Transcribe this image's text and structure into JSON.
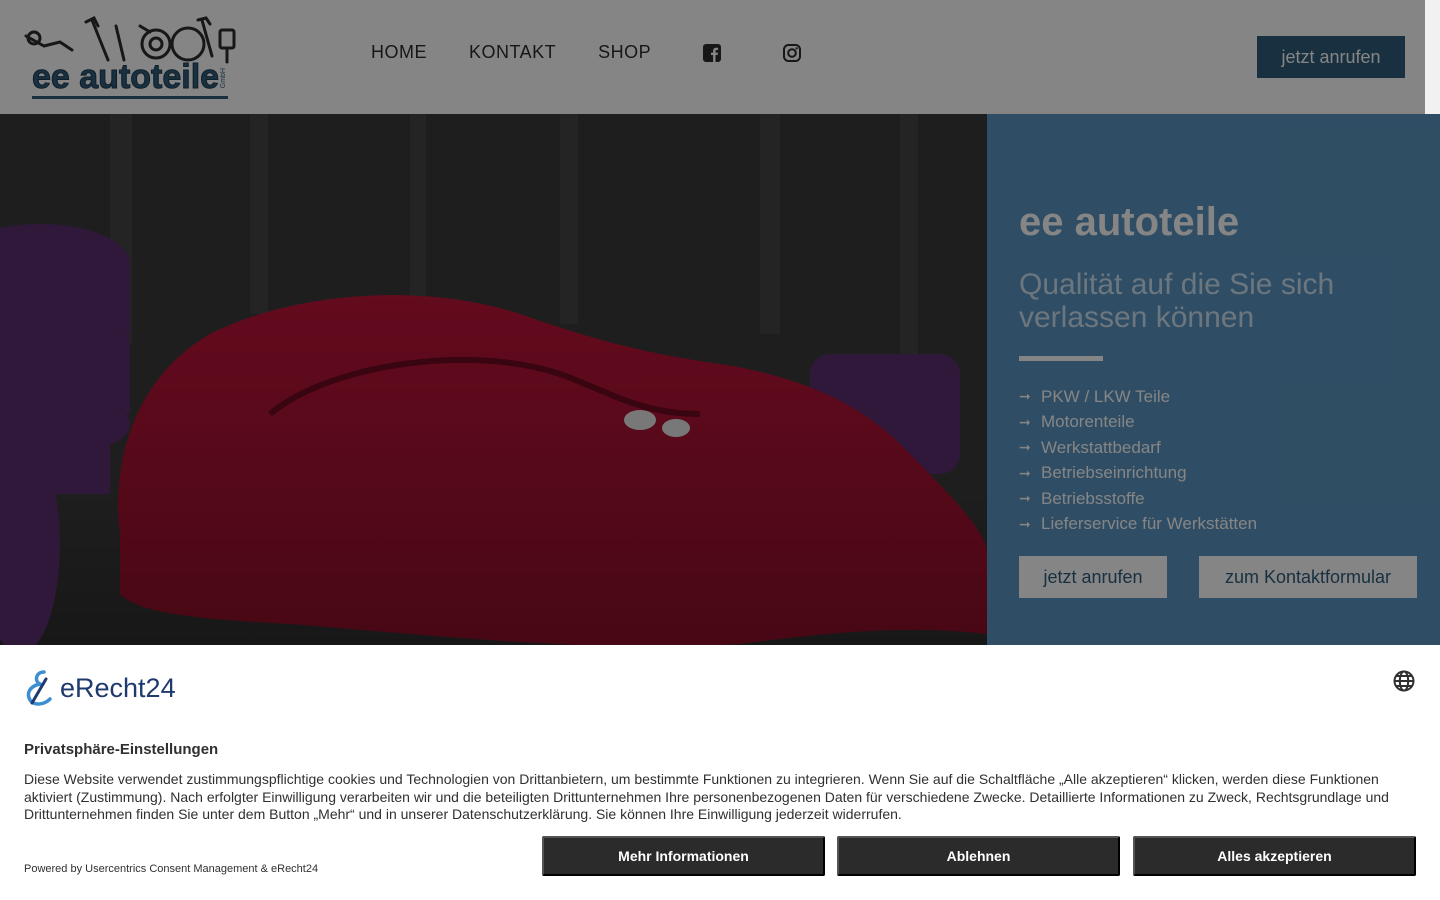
{
  "header": {
    "logo_text": "ee autoteile",
    "logo_suffix": "GmbH",
    "nav": [
      {
        "label": "HOME"
      },
      {
        "label": "KONTAKT"
      },
      {
        "label": "SHOP"
      }
    ],
    "social_icons": [
      "facebook-icon",
      "instagram-icon"
    ],
    "cta_label": "jetzt anrufen"
  },
  "hero": {
    "title": "ee autoteile",
    "subtitle": "Qualität auf die Sie sich verlassen können",
    "features": [
      "PKW / LKW Teile",
      "Motorenteile",
      "Werkstattbedarf",
      "Betriebseinrichtung",
      "Betriebsstoffe",
      "Lieferservice für Werkstätten"
    ],
    "btn_call": "jetzt anrufen",
    "btn_form": "zum Kontaktformular"
  },
  "consent": {
    "brand": "eRecht24",
    "title": "Privatsphäre-Einstellungen",
    "text": "Diese Website verwendet zustimmungspflichtige cookies und Technologien von Drittanbietern, um bestimmte Funktionen zu integrieren. Wenn Sie auf die Schaltfläche „Alle akzeptieren“ klicken, werden diese Funktionen aktiviert (Zustimmung). Nach erfolgter Einwilligung verarbeiten wir und die beteiligten Drittunternehmen Ihre personenbezogenen Daten für verschiedene Zwecke. Detaillierte Informationen zu Zweck, Rechtsgrundlage und Drittunternehmen finden Sie unter dem Button „Mehr“ und in unserer Datenschutzerklärung. Sie können Ihre Einwilligung jederzeit widerrufen.",
    "powered": "Powered by Usercentrics Consent Management & eRecht24",
    "btn_more": "Mehr Informationen",
    "btn_deny": "Ablehnen",
    "btn_accept": "Alles akzeptieren"
  },
  "colors": {
    "brand_blue": "#2f5d7c",
    "panel_blue": "#5b95c0",
    "car_red": "#a3122e",
    "consent_button": "#2b2b2b"
  }
}
